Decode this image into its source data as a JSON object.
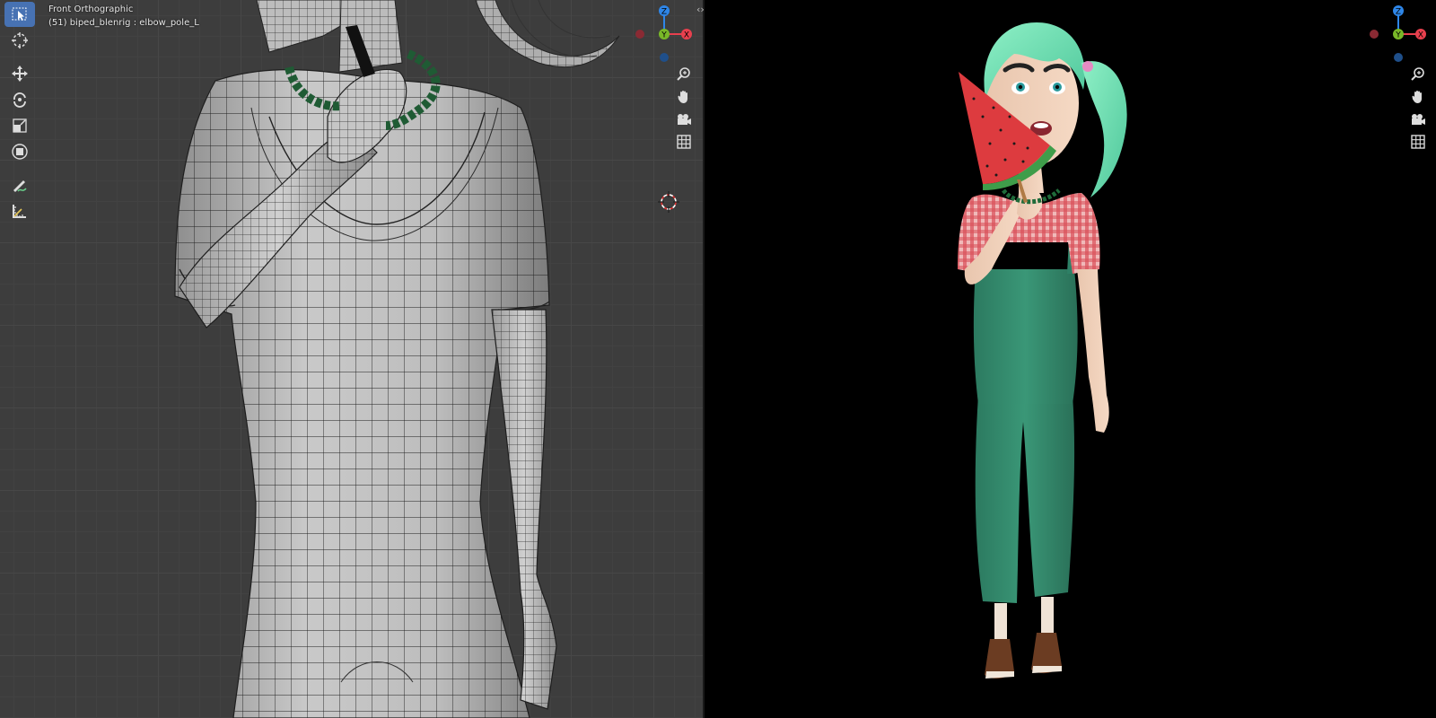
{
  "left_viewport": {
    "view_name": "Front Orthographic",
    "object_info": "(51) biped_blenrig : elbow_pole_L"
  },
  "toolbar": {
    "tools": [
      {
        "name": "select-box",
        "active": true
      },
      {
        "name": "cursor",
        "active": false
      },
      {
        "name": "move",
        "active": false
      },
      {
        "name": "rotate",
        "active": false
      },
      {
        "name": "scale",
        "active": false
      },
      {
        "name": "transform",
        "active": false
      },
      {
        "name": "annotate",
        "active": false
      },
      {
        "name": "measure",
        "active": false
      }
    ]
  },
  "gizmo": {
    "z_label": "Z",
    "y_label": "Y",
    "x_label": "X",
    "x_color": "#e8404e",
    "y_color": "#79b828",
    "z_color": "#2e86e8"
  },
  "nav_buttons": [
    "zoom-icon",
    "pan-hand-icon",
    "camera-icon",
    "grid-icon"
  ],
  "colors": {
    "grid_bg": "#3d3d3d",
    "active_tool": "#4772b3",
    "render_bg": "#000000"
  }
}
